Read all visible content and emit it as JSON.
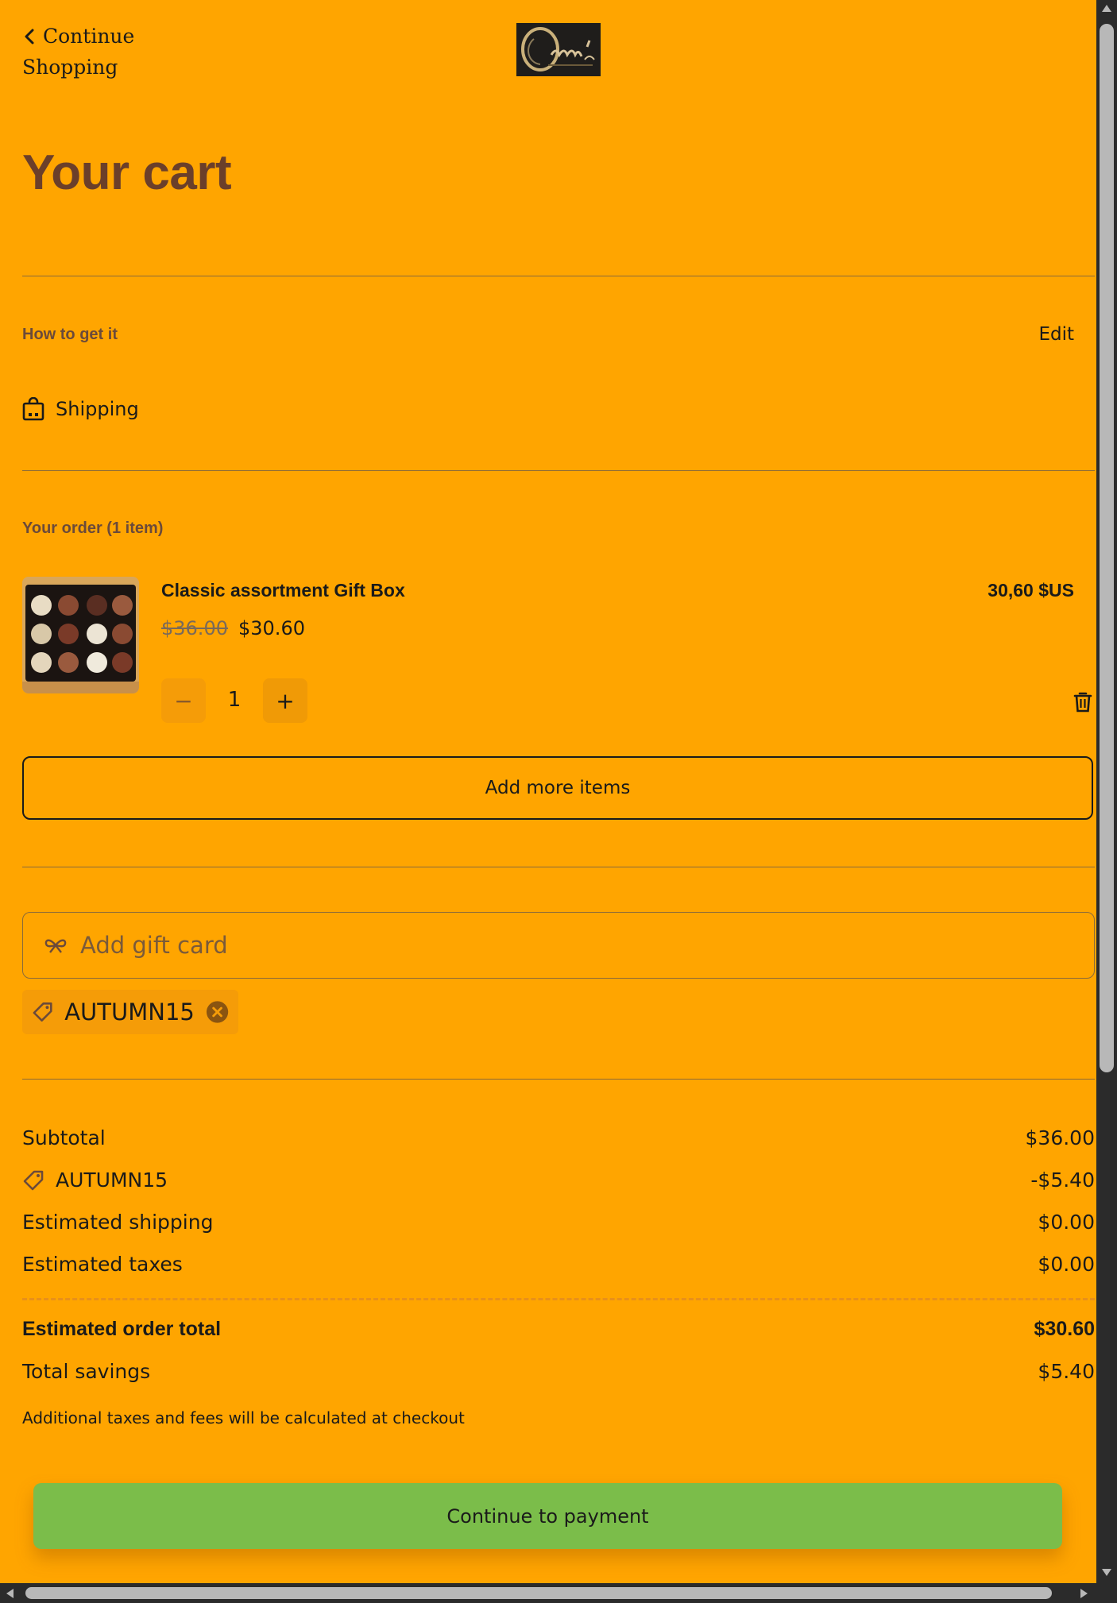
{
  "nav": {
    "back_line1": "Continue",
    "back_line2": "Shopping"
  },
  "logo": {
    "alt": "Corry's logo"
  },
  "cart": {
    "title": "Your cart"
  },
  "fulfillment": {
    "label": "How to get it",
    "edit": "Edit",
    "method": "Shipping"
  },
  "order": {
    "label": "Your order (1 item)",
    "item": {
      "name": "Classic assortment Gift Box",
      "total": "30,60 $US",
      "old_price": "$36.00",
      "price": "$30.60",
      "quantity": "1",
      "minus": "−",
      "plus": "+"
    },
    "add_more": "Add more items"
  },
  "giftcard": {
    "placeholder": "Add gift card"
  },
  "coupon": {
    "code": "AUTUMN15"
  },
  "summary": {
    "subtotal_label": "Subtotal",
    "subtotal": "$36.00",
    "discount_label": "AUTUMN15",
    "discount": "-$5.40",
    "shipping_label": "Estimated shipping",
    "shipping": "$0.00",
    "taxes_label": "Estimated taxes",
    "taxes": "$0.00",
    "total_label": "Estimated order total",
    "total": "$30.60",
    "savings_label": "Total savings",
    "savings": "$5.40",
    "note": "Additional taxes and fees will be calculated at checkout"
  },
  "checkout": {
    "button": "Continue to payment"
  },
  "colors": {
    "background": "#FFA500",
    "title": "#6b3f2a",
    "pay_button": "#7bbd4a"
  }
}
